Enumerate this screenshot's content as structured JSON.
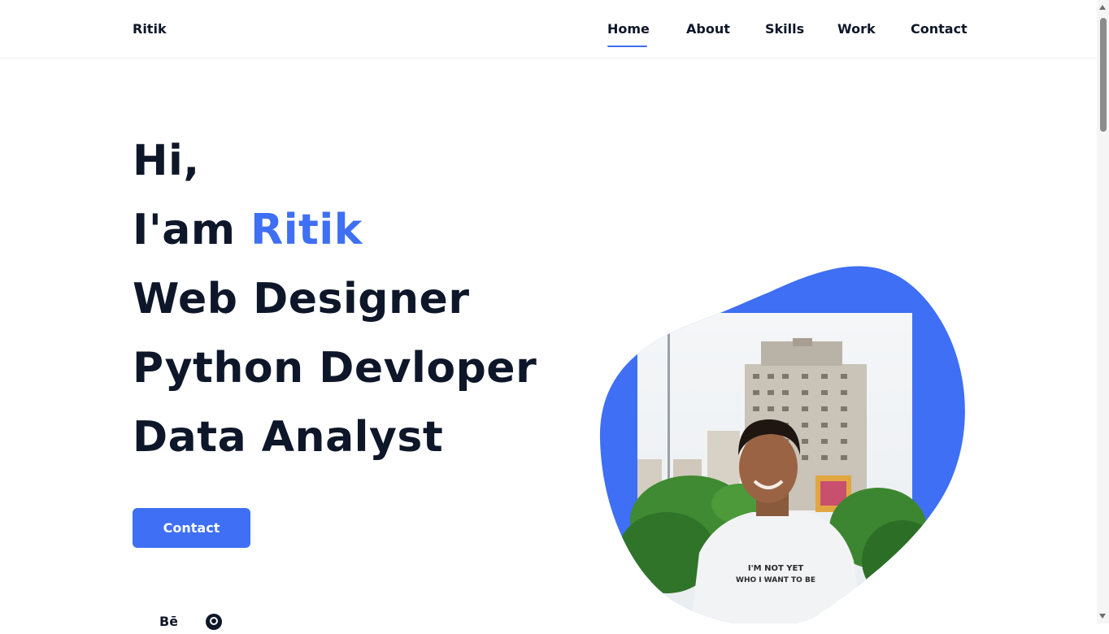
{
  "header": {
    "logo": "Ritik",
    "nav": [
      {
        "label": "Home",
        "active": true
      },
      {
        "label": "About",
        "active": false
      },
      {
        "label": "Skills",
        "active": false
      },
      {
        "label": "Work",
        "active": false
      },
      {
        "label": "Contact",
        "active": false
      }
    ]
  },
  "hero": {
    "greeting": "Hi,",
    "intro_prefix": "I'am ",
    "name": "Ritik",
    "roles": [
      "Web Designer",
      "Python Devloper",
      "Data Analyst"
    ],
    "contact_button": "Contact",
    "shirt_text_line1": "I'M NOT YET",
    "shirt_text_line2": "WHO I WANT TO BE"
  },
  "social_icons": [
    "behance-icon",
    "github-icon"
  ],
  "colors": {
    "accent": "#3e6ff4",
    "text": "#0e1729",
    "background": "#ffffff"
  }
}
